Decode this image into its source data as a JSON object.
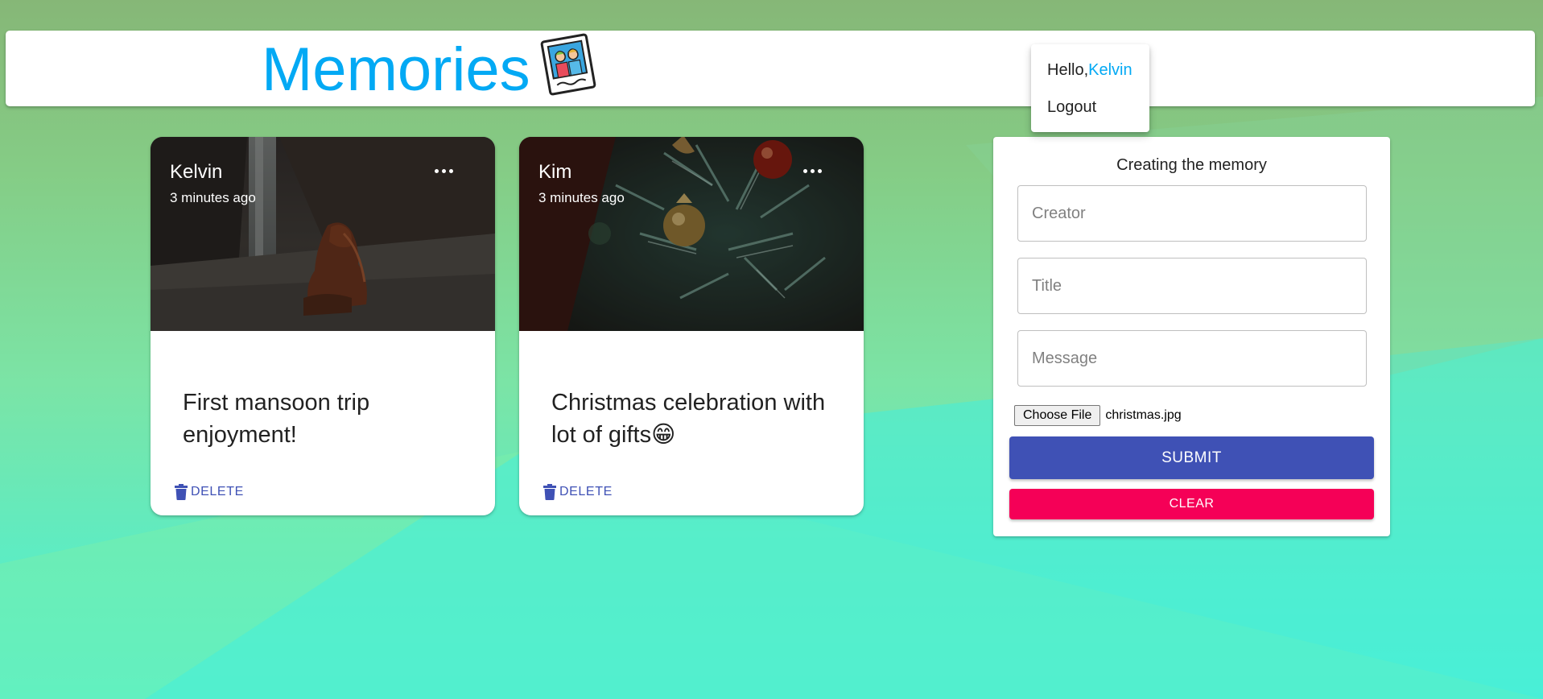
{
  "header": {
    "title": "Memories",
    "logo_icon": "photo-frame-icon"
  },
  "user_menu": {
    "greeting": "Hello,",
    "username": "Kelvin",
    "logout_label": "Logout"
  },
  "posts": [
    {
      "creator": "Kelvin",
      "time": "3 minutes ago",
      "title": "First mansoon trip enjoyment!",
      "image_icon": "waterfall-photo",
      "delete_label": "DELETE"
    },
    {
      "creator": "Kim",
      "time": "3 minutes ago",
      "title": "Christmas celebration with lot of gifts😁",
      "image_icon": "christmas-tree-photo",
      "delete_label": "DELETE"
    }
  ],
  "form": {
    "heading": "Creating the memory",
    "creator_placeholder": "Creator",
    "title_placeholder": "Title",
    "message_placeholder": "Message",
    "choose_file_label": "Choose File",
    "file_name": "christmas.jpg",
    "submit_label": "SUBMIT",
    "clear_label": "CLEAR"
  },
  "colors": {
    "brand": "#03a9f4",
    "primary": "#3f51b5",
    "secondary": "#f50057"
  }
}
